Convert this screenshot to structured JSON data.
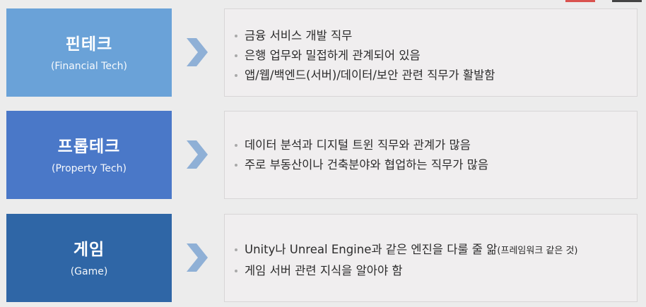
{
  "rows": [
    {
      "title": "핀테크",
      "subtitle": "(Financial Tech)",
      "color": "#6aa2d8",
      "items": [
        "금융 서비스 개발 직무",
        "은행 업무와 밀접하게 관계되어 있음",
        "앱/웹/백엔드(서버)/데이터/보안 관련 직무가 활발함"
      ]
    },
    {
      "title": "프롭테크",
      "subtitle": "(Property Tech)",
      "color": "#4a78c8",
      "items": [
        "데이터 분석과 디지털 트윈 직무와 관계가 많음",
        "주로 부동산이나 건축분야와 협업하는 직무가 많음"
      ]
    },
    {
      "title": "게임",
      "subtitle": "(Game)",
      "color": "#2f66a6",
      "items": [
        "Unity나 Unreal Engine과 같은 엔진을 다룰 줄 앎",
        "게임 서버 관련 지식을 알아야 함"
      ],
      "note": "(프레임워크 같은 것)"
    }
  ],
  "arrow_color": "#8fb0d6",
  "bullet_color": "#a9a9a9"
}
